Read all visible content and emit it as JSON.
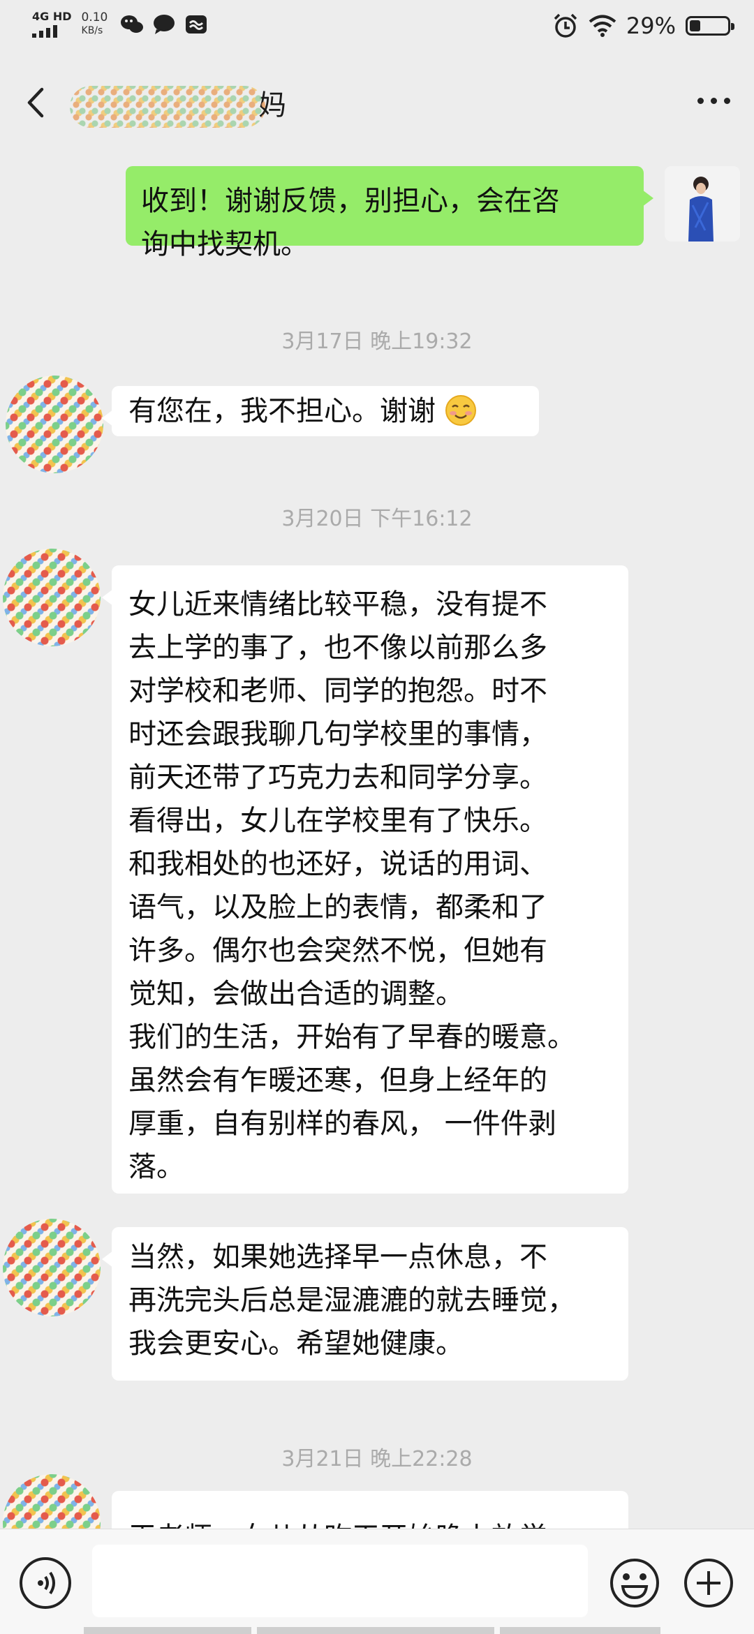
{
  "status_bar": {
    "network": "4G HD",
    "speed_value": "0.10",
    "speed_unit": "KB/s",
    "battery": "29%",
    "battery_level": 0.29
  },
  "header": {
    "title_suffix": "妈"
  },
  "messages": [
    {
      "type": "out",
      "text": "收到！谢谢反馈，别担心，会在咨\n询中找契机。"
    },
    {
      "type": "time",
      "text": "3月17日 晚上19:32"
    },
    {
      "type": "in",
      "text": "有您在，我不担心。谢谢"
    },
    {
      "type": "time",
      "text": "3月20日 下午16:12"
    },
    {
      "type": "in",
      "text": "女儿近来情绪比较平稳，没有提不\n去上学的事了，也不像以前那么多\n对学校和老师、同学的抱怨。时不\n时还会跟我聊几句学校里的事情，\n前天还带了巧克力去和同学分享。\n看得出，女儿在学校里有了快乐。\n和我相处的也还好，说话的用词、\n语气，以及脸上的表情，都柔和了\n许多。偶尔也会突然不悦，但她有\n觉知，会做出合适的调整。\n我们的生活，开始有了早春的暖意。\n虽然会有乍暖还寒，但身上经年的\n厚重，自有别样的春风， 一件件剥\n落。"
    },
    {
      "type": "in",
      "text": "当然，如果她选择早一点休息，不\n再洗完头后总是湿漉漉的就去睡觉，\n我会更安心。希望她健康。"
    },
    {
      "type": "time",
      "text": "3月21日 晚上22:28"
    },
    {
      "type": "in",
      "text": "王老师，女儿从昨天开始晚上放学"
    }
  ],
  "input": {
    "placeholder": ""
  }
}
